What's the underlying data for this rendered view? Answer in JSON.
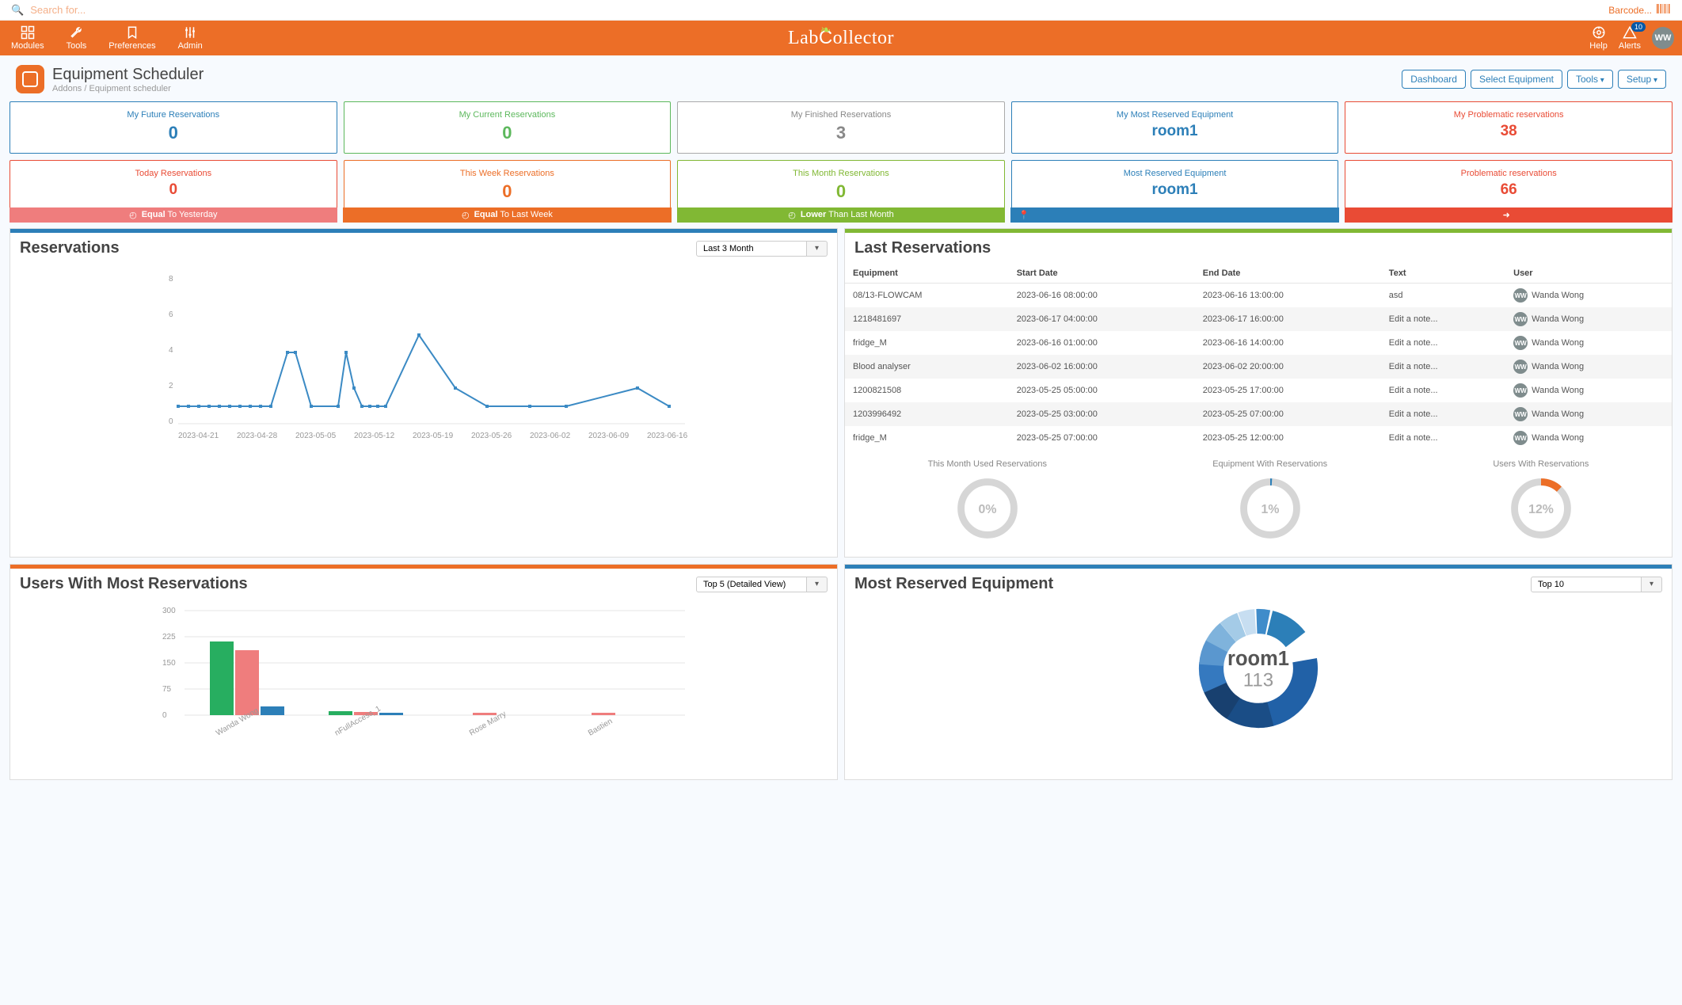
{
  "search": {
    "placeholder": "Search for...",
    "barcode_label": "Barcode..."
  },
  "nav": {
    "items": [
      {
        "label": "Modules"
      },
      {
        "label": "Tools"
      },
      {
        "label": "Preferences"
      },
      {
        "label": "Admin"
      }
    ],
    "brand": "LabCollector",
    "help": "Help",
    "alerts": "Alerts",
    "alerts_badge": "10",
    "user_initials": "WW"
  },
  "page": {
    "title": "Equipment Scheduler",
    "crumbs": "Addons / Equipment scheduler",
    "buttons": {
      "dashboard": "Dashboard",
      "select_equipment": "Select Equipment",
      "tools": "Tools",
      "setup": "Setup"
    }
  },
  "stats_row1": [
    {
      "label": "My Future Reservations",
      "value": "0",
      "color": "blue"
    },
    {
      "label": "My Current Reservations",
      "value": "0",
      "color": "green"
    },
    {
      "label": "My Finished Reservations",
      "value": "3",
      "color": "grey"
    },
    {
      "label": "My Most Reserved Equipment",
      "value": "room1",
      "color": "filledblue"
    },
    {
      "label": "My Problematic reservations",
      "value": "38",
      "color": "red"
    }
  ],
  "stats_row2": [
    {
      "label": "Today Reservations",
      "value": "0",
      "color": "red",
      "footer_color": "coral",
      "footer_bold": "Equal",
      "footer_rest": " To Yesterday",
      "icon": "clock"
    },
    {
      "label": "This Week Reservations",
      "value": "0",
      "color": "orange",
      "footer_color": "orange",
      "footer_bold": "Equal",
      "footer_rest": " To Last Week",
      "icon": "clock"
    },
    {
      "label": "This Month Reservations",
      "value": "0",
      "color": "yg",
      "footer_color": "green",
      "footer_bold": "Lower",
      "footer_rest": " Than Last Month",
      "icon": "clock"
    },
    {
      "label": "Most Reserved Equipment",
      "value": "room1",
      "color": "filledblue",
      "footer_color": "blue",
      "footer_bold": "",
      "footer_rest": "",
      "icon": "pin"
    },
    {
      "label": "Problematic reservations",
      "value": "66",
      "color": "red",
      "footer_color": "red",
      "footer_bold": "",
      "footer_rest": "",
      "icon": "arrow"
    }
  ],
  "reservations_panel": {
    "title": "Reservations",
    "selector": "Last 3 Month"
  },
  "last_res_panel": {
    "title": "Last Reservations",
    "headers": {
      "equipment": "Equipment",
      "start": "Start Date",
      "end": "End Date",
      "text": "Text",
      "user": "User"
    },
    "rows": [
      {
        "equipment": "08/13-FLOWCAM",
        "start": "2023-06-16 08:00:00",
        "end": "2023-06-16 13:00:00",
        "text": "asd",
        "user": "Wanda Wong"
      },
      {
        "equipment": "1218481697",
        "start": "2023-06-17 04:00:00",
        "end": "2023-06-17 16:00:00",
        "text": "Edit a note...",
        "user": "Wanda Wong"
      },
      {
        "equipment": "fridge_M",
        "start": "2023-06-16 01:00:00",
        "end": "2023-06-16 14:00:00",
        "text": "Edit a note...",
        "user": "Wanda Wong"
      },
      {
        "equipment": "Blood analyser",
        "start": "2023-06-02 16:00:00",
        "end": "2023-06-02 20:00:00",
        "text": "Edit a note...",
        "user": "Wanda Wong"
      },
      {
        "equipment": "1200821508",
        "start": "2023-05-25 05:00:00",
        "end": "2023-05-25 17:00:00",
        "text": "Edit a note...",
        "user": "Wanda Wong"
      },
      {
        "equipment": "1203996492",
        "start": "2023-05-25 03:00:00",
        "end": "2023-05-25 07:00:00",
        "text": "Edit a note...",
        "user": "Wanda Wong"
      },
      {
        "equipment": "fridge_M",
        "start": "2023-05-25 07:00:00",
        "end": "2023-05-25 12:00:00",
        "text": "Edit a note...",
        "user": "Wanda Wong"
      }
    ],
    "gauges": [
      {
        "label": "This Month Used Reservations",
        "pct": "0%",
        "value": 0,
        "color": "#ccc"
      },
      {
        "label": "Equipment With Reservations",
        "pct": "1%",
        "value": 1,
        "color": "#2c7fb8"
      },
      {
        "label": "Users With Reservations",
        "pct": "12%",
        "value": 12,
        "color": "#ec6e27"
      }
    ]
  },
  "users_panel": {
    "title": "Users With Most Reservations",
    "selector": "Top 5 (Detailed View)"
  },
  "equip_panel": {
    "title": "Most Reserved Equipment",
    "selector": "Top 10",
    "center_label": "room1",
    "center_value": "113"
  },
  "chart_data": [
    {
      "type": "line",
      "id": "reservations_timeseries",
      "title": "Reservations",
      "xlabel": "",
      "ylabel": "",
      "ylim": [
        0,
        8
      ],
      "x": [
        "2023-04-21",
        "2023-04-28",
        "2023-05-05",
        "2023-05-12",
        "2023-05-19",
        "2023-05-26",
        "2023-06-02",
        "2023-06-09",
        "2023-06-16"
      ],
      "series": [
        {
          "name": "reservations",
          "points": [
            {
              "x": "2023-04-21",
              "y": 1
            },
            {
              "x": "2023-04-22",
              "y": 1
            },
            {
              "x": "2023-04-23",
              "y": 1
            },
            {
              "x": "2023-04-24",
              "y": 1
            },
            {
              "x": "2023-04-25",
              "y": 1
            },
            {
              "x": "2023-04-26",
              "y": 1
            },
            {
              "x": "2023-04-27",
              "y": 1
            },
            {
              "x": "2023-04-28",
              "y": 1
            },
            {
              "x": "2023-04-29",
              "y": 1
            },
            {
              "x": "2023-04-30",
              "y": 1
            },
            {
              "x": "2023-05-03",
              "y": 4
            },
            {
              "x": "2023-05-04",
              "y": 4
            },
            {
              "x": "2023-05-06",
              "y": 1
            },
            {
              "x": "2023-05-10",
              "y": 1
            },
            {
              "x": "2023-05-11",
              "y": 4
            },
            {
              "x": "2023-05-12",
              "y": 2
            },
            {
              "x": "2023-05-13",
              "y": 1
            },
            {
              "x": "2023-05-14",
              "y": 1
            },
            {
              "x": "2023-05-15",
              "y": 1
            },
            {
              "x": "2023-05-16",
              "y": 1
            },
            {
              "x": "2023-05-20",
              "y": 5
            },
            {
              "x": "2023-05-24",
              "y": 2
            },
            {
              "x": "2023-05-28",
              "y": 1
            },
            {
              "x": "2023-06-02",
              "y": 1
            },
            {
              "x": "2023-06-06",
              "y": 1
            },
            {
              "x": "2023-06-14",
              "y": 2
            },
            {
              "x": "2023-06-16",
              "y": 1
            }
          ]
        }
      ]
    },
    {
      "type": "bar",
      "id": "users_most_reservations",
      "title": "Users With Most Reservations",
      "ylabel": "",
      "xlabel": "",
      "ylim": [
        0,
        300
      ],
      "yticks": [
        0,
        75,
        150,
        225,
        300
      ],
      "categories": [
        "Wanda Wong",
        "nFullAccess_1",
        "Rose Marry",
        "Bastien"
      ],
      "series": [
        {
          "name": "green",
          "color": "#27ae60",
          "values": [
            210,
            10,
            0,
            0
          ]
        },
        {
          "name": "salmon",
          "color": "#ef7d7d",
          "values": [
            185,
            8,
            5,
            4
          ]
        },
        {
          "name": "blue",
          "color": "#2c7fb8",
          "values": [
            25,
            5,
            2,
            2
          ]
        }
      ]
    },
    {
      "type": "pie",
      "id": "most_reserved_equipment_donut",
      "title": "Most Reserved Equipment",
      "center_label": "room1",
      "center_value": 113,
      "slices": [
        {
          "value": 113,
          "color": "#2161a7"
        },
        {
          "value": 60,
          "color": "#1a4d86"
        },
        {
          "value": 40,
          "color": "#3579bf"
        },
        {
          "value": 30,
          "color": "#5a97cf"
        },
        {
          "value": 25,
          "color": "#7fb3dc"
        },
        {
          "value": 20,
          "color": "#a4cbe7"
        },
        {
          "value": 18,
          "color": "#c7def1"
        },
        {
          "value": 14,
          "color": "#2c7fb8"
        },
        {
          "value": 10,
          "color": "#18406f"
        },
        {
          "value": 8,
          "color": "#3f8cca"
        }
      ]
    }
  ]
}
